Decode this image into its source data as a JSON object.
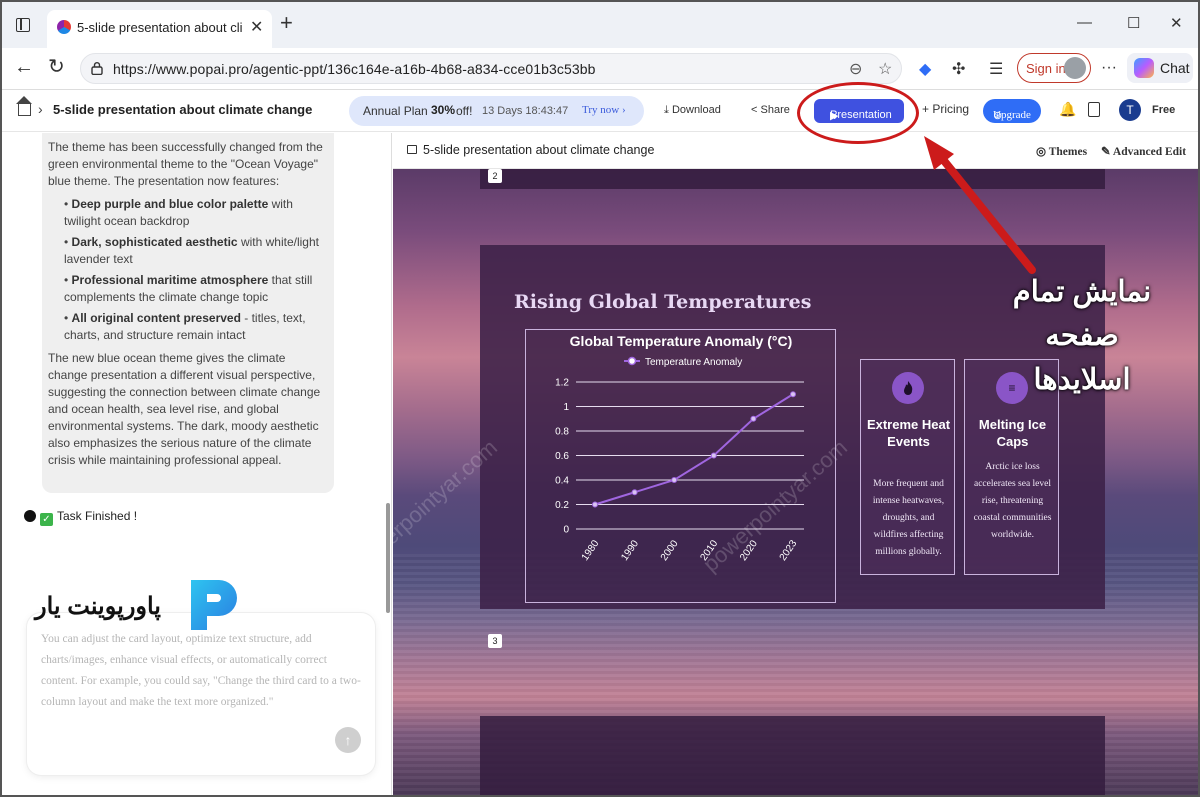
{
  "browser": {
    "tab_title": "5-slide presentation about climate change",
    "tab_close": "✕",
    "new_tab": "+",
    "window_controls": [
      "—",
      "☐",
      "✕"
    ],
    "url": "https://www.popai.pro/agentic-ppt/136c164e-a16b-4b68-a834-cce01b3c53bb",
    "sign_in_label": "Sign in",
    "chat_label": "Chat",
    "more_label": "···"
  },
  "header": {
    "breadcrumb_sep": "›",
    "breadcrumb_title": "5-slide presentation about climate change",
    "promo": {
      "plan": "Annual Plan",
      "discount": "30%",
      "off": "off!",
      "countdown": "13 Days 18:43:47",
      "try_now": "Try now ›"
    },
    "download_label": "Download",
    "share_label": "Share",
    "presentation_label": "Presentation",
    "pricing_label": "Pricing",
    "upgrade_label": "Upgrade",
    "avatar_letter": "T",
    "plan_label": "Free"
  },
  "chat": {
    "intro": "The theme has been successfully changed from the green environmental theme to the \"Ocean Voyage\" blue theme. The presentation now features:",
    "bullets": [
      {
        "bold": "Deep purple and blue color palette",
        "text": " with twilight ocean backdrop"
      },
      {
        "bold": "Dark, sophisticated aesthetic",
        "text": " with white/light lavender text"
      },
      {
        "bold": "Professional maritime atmosphere",
        "text": " that still complements the climate change topic"
      },
      {
        "bold": "All original content preserved",
        "text": " - titles, text, charts, and structure remain intact"
      }
    ],
    "outro": "The new blue ocean theme gives the climate change presentation a different visual perspective, suggesting the connection between climate change and ocean health, sea level rise, and global environmental systems. The dark, moody aesthetic also emphasizes the serious nature of the climate crisis while maintaining professional appeal.",
    "status": "Task Finished !",
    "input_placeholder": "You can adjust the card layout, optimize text structure, add charts/images, enhance visual effects, or automatically correct content. For example, you could say, \"Change the third card to a two-column layout and make the text more organized.\""
  },
  "editor": {
    "title": "5-slide presentation about climate change",
    "themes_label": "Themes",
    "advanced_edit_label": "Advanced Edit",
    "slide_numbers": [
      "2",
      "3"
    ]
  },
  "slide": {
    "title": "Rising Global Temperatures",
    "cards": [
      {
        "icon": "flame-icon",
        "icon_glyph": "🔥",
        "title": "Extreme Heat Events",
        "desc": "More frequent and intense heatwaves, droughts, and wildfires affecting millions globally."
      },
      {
        "icon": "list-icon",
        "icon_glyph": "≡",
        "title": "Melting Ice Caps",
        "desc": "Arctic ice loss accelerates sea level rise, threatening coastal communities worldwide."
      }
    ]
  },
  "chart_data": {
    "type": "line",
    "title": "Global Temperature Anomaly (°C)",
    "xlabel": "",
    "ylabel": "",
    "categories": [
      "1980",
      "1990",
      "2000",
      "2010",
      "2020",
      "2023"
    ],
    "series": [
      {
        "name": "Temperature Anomaly",
        "values": [
          0.2,
          0.3,
          0.4,
          0.6,
          0.9,
          1.1
        ]
      }
    ],
    "yticks": [
      "0",
      "0.2",
      "0.4",
      "0.6",
      "0.8",
      "1",
      "1.2"
    ],
    "ylim": [
      0,
      1.2
    ],
    "grid": true,
    "legend": "top-center",
    "color": "#a066e0"
  },
  "annotation": {
    "caption": "نمایش تمام صفحه اسلایدها",
    "brand_text": "پاورپوینت یار",
    "watermark": "powerpointyar.com",
    "color": "#cc1b1b"
  }
}
